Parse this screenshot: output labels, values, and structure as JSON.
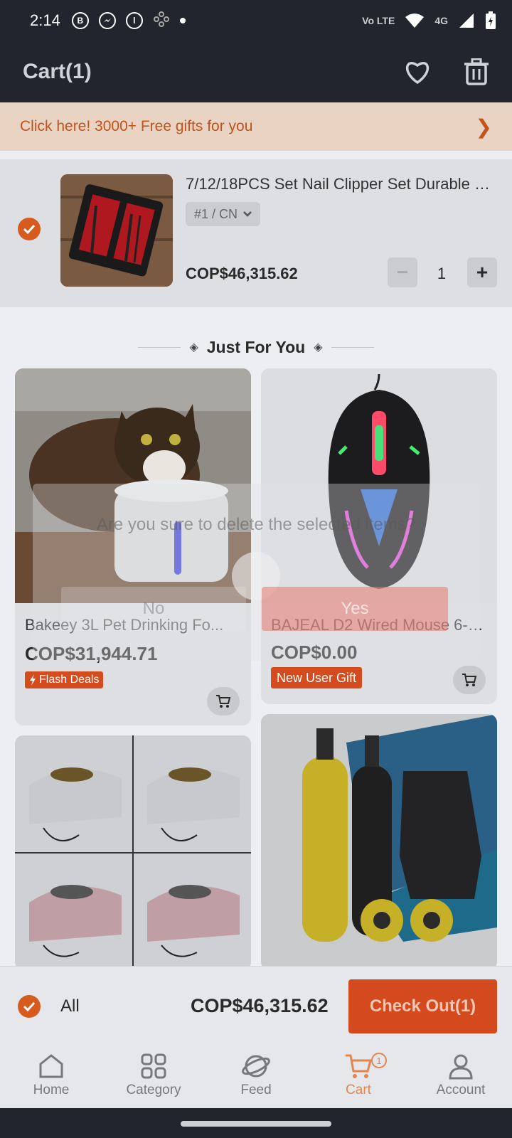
{
  "status_bar": {
    "time": "2:14",
    "icons": [
      "b-icon",
      "messenger-icon",
      "app-icon",
      "dots-icon"
    ],
    "network": "4G",
    "volte": "Vo LTE"
  },
  "header": {
    "title": "Cart(1)"
  },
  "promo": {
    "text": "Click here! 3000+ Free gifts for you",
    "arrow": "❯"
  },
  "cart_item": {
    "title": "7/12/18PCS Set Nail Clipper Set Durable Na...",
    "variant": "#1 / CN",
    "price": "COP$46,315.62",
    "quantity": "1",
    "minus": "−",
    "plus": "+"
  },
  "section": {
    "title": "Just For You"
  },
  "products": [
    {
      "title": "Bakeey 3L Pet Drinking Fo...",
      "price": "COP$31,944.71",
      "badge": "Flash Deals"
    },
    {
      "title": "BAJEAL D2 Wired Mouse 6-Bu...",
      "price": "COP$0.00",
      "badge": "New User Gift"
    }
  ],
  "dialog": {
    "message": "Are you sure to delete the selected items?",
    "no": "No",
    "yes": "Yes"
  },
  "bottom_bar": {
    "all": "All",
    "total": "COP$46,315.62",
    "checkout": "Check Out(1)"
  },
  "nav": {
    "items": [
      {
        "label": "Home",
        "icon": "home-icon"
      },
      {
        "label": "Category",
        "icon": "grid-icon"
      },
      {
        "label": "Feed",
        "icon": "planet-icon"
      },
      {
        "label": "Cart",
        "icon": "cart-icon"
      },
      {
        "label": "Account",
        "icon": "user-icon"
      }
    ],
    "cart_badge": "1",
    "active_color": "#e3864e"
  }
}
